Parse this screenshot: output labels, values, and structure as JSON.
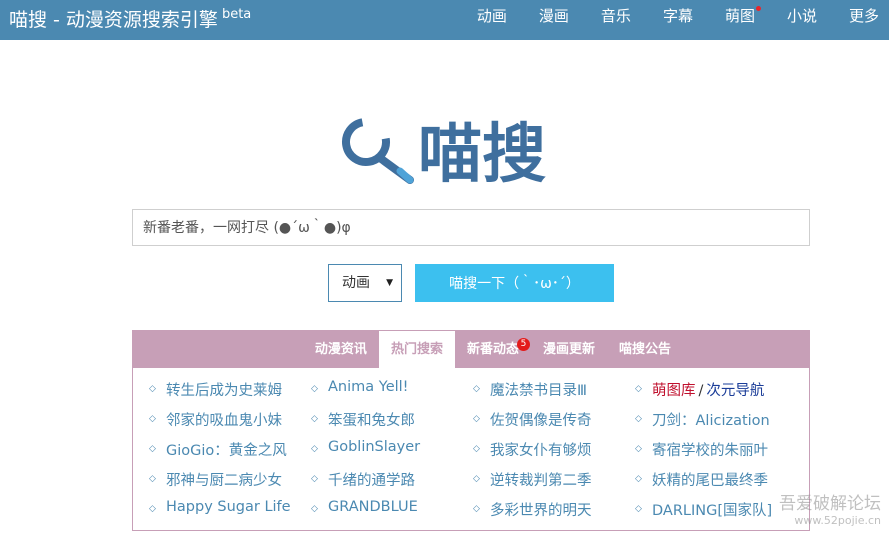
{
  "header": {
    "brand": "喵搜 - 动漫资源搜索引擎",
    "beta": "beta",
    "nav": [
      {
        "label": "动画"
      },
      {
        "label": "漫画"
      },
      {
        "label": "音乐"
      },
      {
        "label": "字幕"
      },
      {
        "label": "萌图",
        "dot": true
      },
      {
        "label": "小说"
      },
      {
        "label": "更多"
      }
    ]
  },
  "logo": {
    "text": "喵搜",
    "color": "#3f6f9e"
  },
  "search": {
    "placeholder": "新番老番，一网打尽 (●´ω｀●)φ",
    "category": "动画",
    "button": "喵搜一下（｀･ω･´）"
  },
  "panel": {
    "tabs": [
      {
        "label": "动漫资讯"
      },
      {
        "label": "热门搜索",
        "active": true
      },
      {
        "label": "新番动态",
        "badge": "5"
      },
      {
        "label": "漫画更新"
      },
      {
        "label": "喵搜公告"
      }
    ],
    "columns": [
      [
        "转生后成为史莱姆",
        "邻家的吸血鬼小妹",
        "GioGio：黄金之风",
        "邪神与厨二病少女",
        "Happy Sugar Life"
      ],
      [
        "Anima Yell!",
        "笨蛋和兔女郎",
        "GoblinSlayer",
        "千绪的通学路",
        "GRANDBLUE"
      ],
      [
        "魔法禁书目录Ⅲ",
        "佐贺偶像是传奇",
        "我家女仆有够烦",
        "逆转裁判第二季",
        "多彩世界的明天"
      ],
      [
        "",
        "刀剑：Alicization",
        "寄宿学校的朱丽叶",
        "妖精的尾巴最终季",
        "DARLING[国家队]"
      ]
    ],
    "special": {
      "left": "萌图库",
      "sep": "/",
      "right": "次元导航"
    }
  },
  "watermark": {
    "text": "吾爱破解论坛",
    "url": "www.52pojie.cn"
  },
  "colors": {
    "header_bg": "#4b89b1",
    "button_bg": "#3cc0ef",
    "panel_accent": "#c79fb7",
    "link": "#4b89b1"
  }
}
